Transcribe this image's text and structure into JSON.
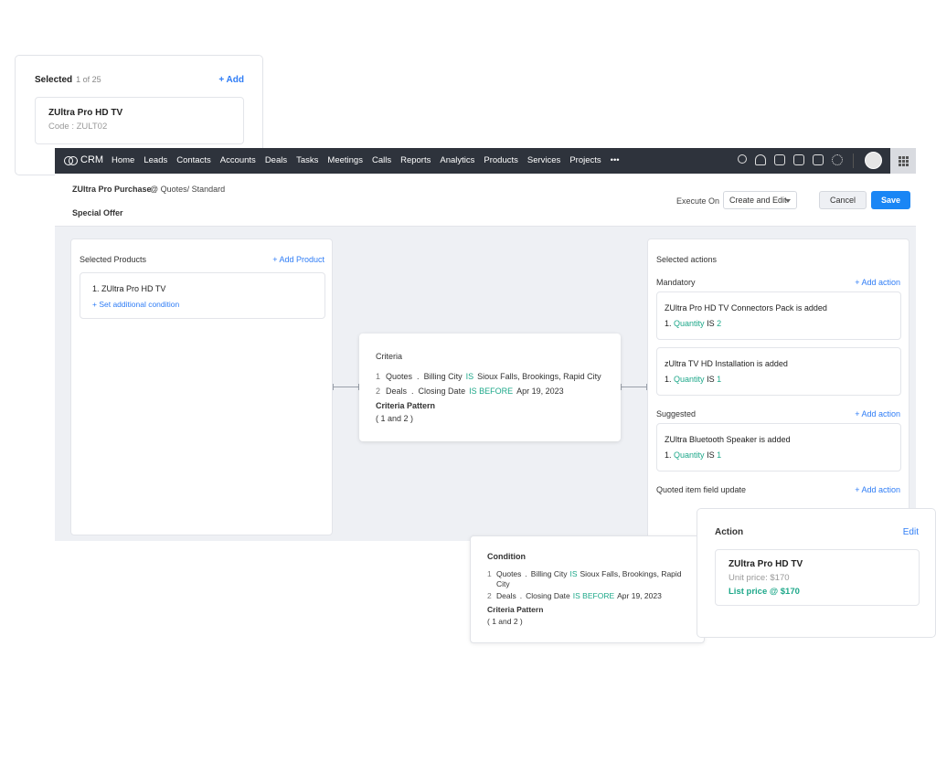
{
  "selected_card": {
    "title": "Selected",
    "count": "1 of 25",
    "add_label": "+ Add",
    "item_name": "ZUltra Pro HD TV",
    "item_code": "Code : ZULT02"
  },
  "topbar": {
    "logo": "CRM",
    "nav": [
      "Home",
      "Leads",
      "Contacts",
      "Accounts",
      "Deals",
      "Tasks",
      "Meetings",
      "Calls",
      "Reports",
      "Analytics",
      "Products",
      "Services",
      "Projects",
      "•••"
    ],
    "icons": [
      "search-icon",
      "bell-icon",
      "add-note-icon",
      "calendar-icon",
      "store-icon",
      "gear-icon"
    ]
  },
  "subheader": {
    "title": "ZUltra Pro Purchase",
    "crumb": "@ Quotes/ Standard",
    "special": "Special Offer",
    "execute_label": "Execute On",
    "execute_value": "Create and Edit",
    "cancel_label": "Cancel",
    "save_label": "Save"
  },
  "products_panel": {
    "title": "Selected Products",
    "add_label": "+ Add Product",
    "item_name": "1. ZUltra Pro HD TV",
    "condition_link": "+ Set additional condition"
  },
  "criteria": {
    "title": "Criteria",
    "rows": [
      {
        "n": "1",
        "module": "Quotes",
        "field": "Billing City",
        "op": "IS",
        "value": "Sioux Falls, Brookings, Rapid City"
      },
      {
        "n": "2",
        "module": "Deals",
        "field": "Closing Date",
        "op": "IS BEFORE",
        "value": "Apr 19, 2023"
      }
    ],
    "pattern_title": "Criteria Pattern",
    "pattern_value": "( 1 and 2 )"
  },
  "actions_panel": {
    "title": "Selected actions",
    "mandatory_title": "Mandatory",
    "suggested_title": "Suggested",
    "field_update_title": "Quoted item field update",
    "add_label": "+ Add action",
    "mandatory": [
      {
        "title": "ZUltra Pro HD TV Connectors Pack is added",
        "prefix": "1.",
        "field": "Quantity",
        "op": "IS",
        "value": "2"
      },
      {
        "title": "zUltra TV HD Installation is added",
        "prefix": "1.",
        "field": "Quantity",
        "op": "IS",
        "value": "1"
      }
    ],
    "suggested": [
      {
        "title": "ZUltra Bluetooth Speaker is added",
        "prefix": "1.",
        "field": "Quantity",
        "op": "IS",
        "value": "1"
      }
    ]
  },
  "condition_card": {
    "title": "Condition",
    "rows": [
      {
        "n": "1",
        "module": "Quotes",
        "field": "Billing City",
        "op": "IS",
        "value": "Sioux Falls, Brookings, Rapid",
        "value_wrap": "City"
      },
      {
        "n": "2",
        "module": "Deals",
        "field": "Closing Date",
        "op": "IS BEFORE",
        "value": "Apr 19, 2023",
        "value_wrap": ""
      }
    ],
    "pattern_title": "Criteria Pattern",
    "pattern_value": "( 1 and 2 )"
  },
  "action_card": {
    "title": "Action",
    "edit_label": "Edit",
    "item_name": "ZUltra Pro HD TV",
    "unit_price": "Unit price: $170",
    "list_price": "List price @ $170"
  },
  "colors": {
    "accent": "#2f7df6",
    "save_button": "#1a86f5",
    "operator_green": "#1ea88a",
    "topbar": "#2e333c",
    "canvas": "#eef0f4"
  }
}
